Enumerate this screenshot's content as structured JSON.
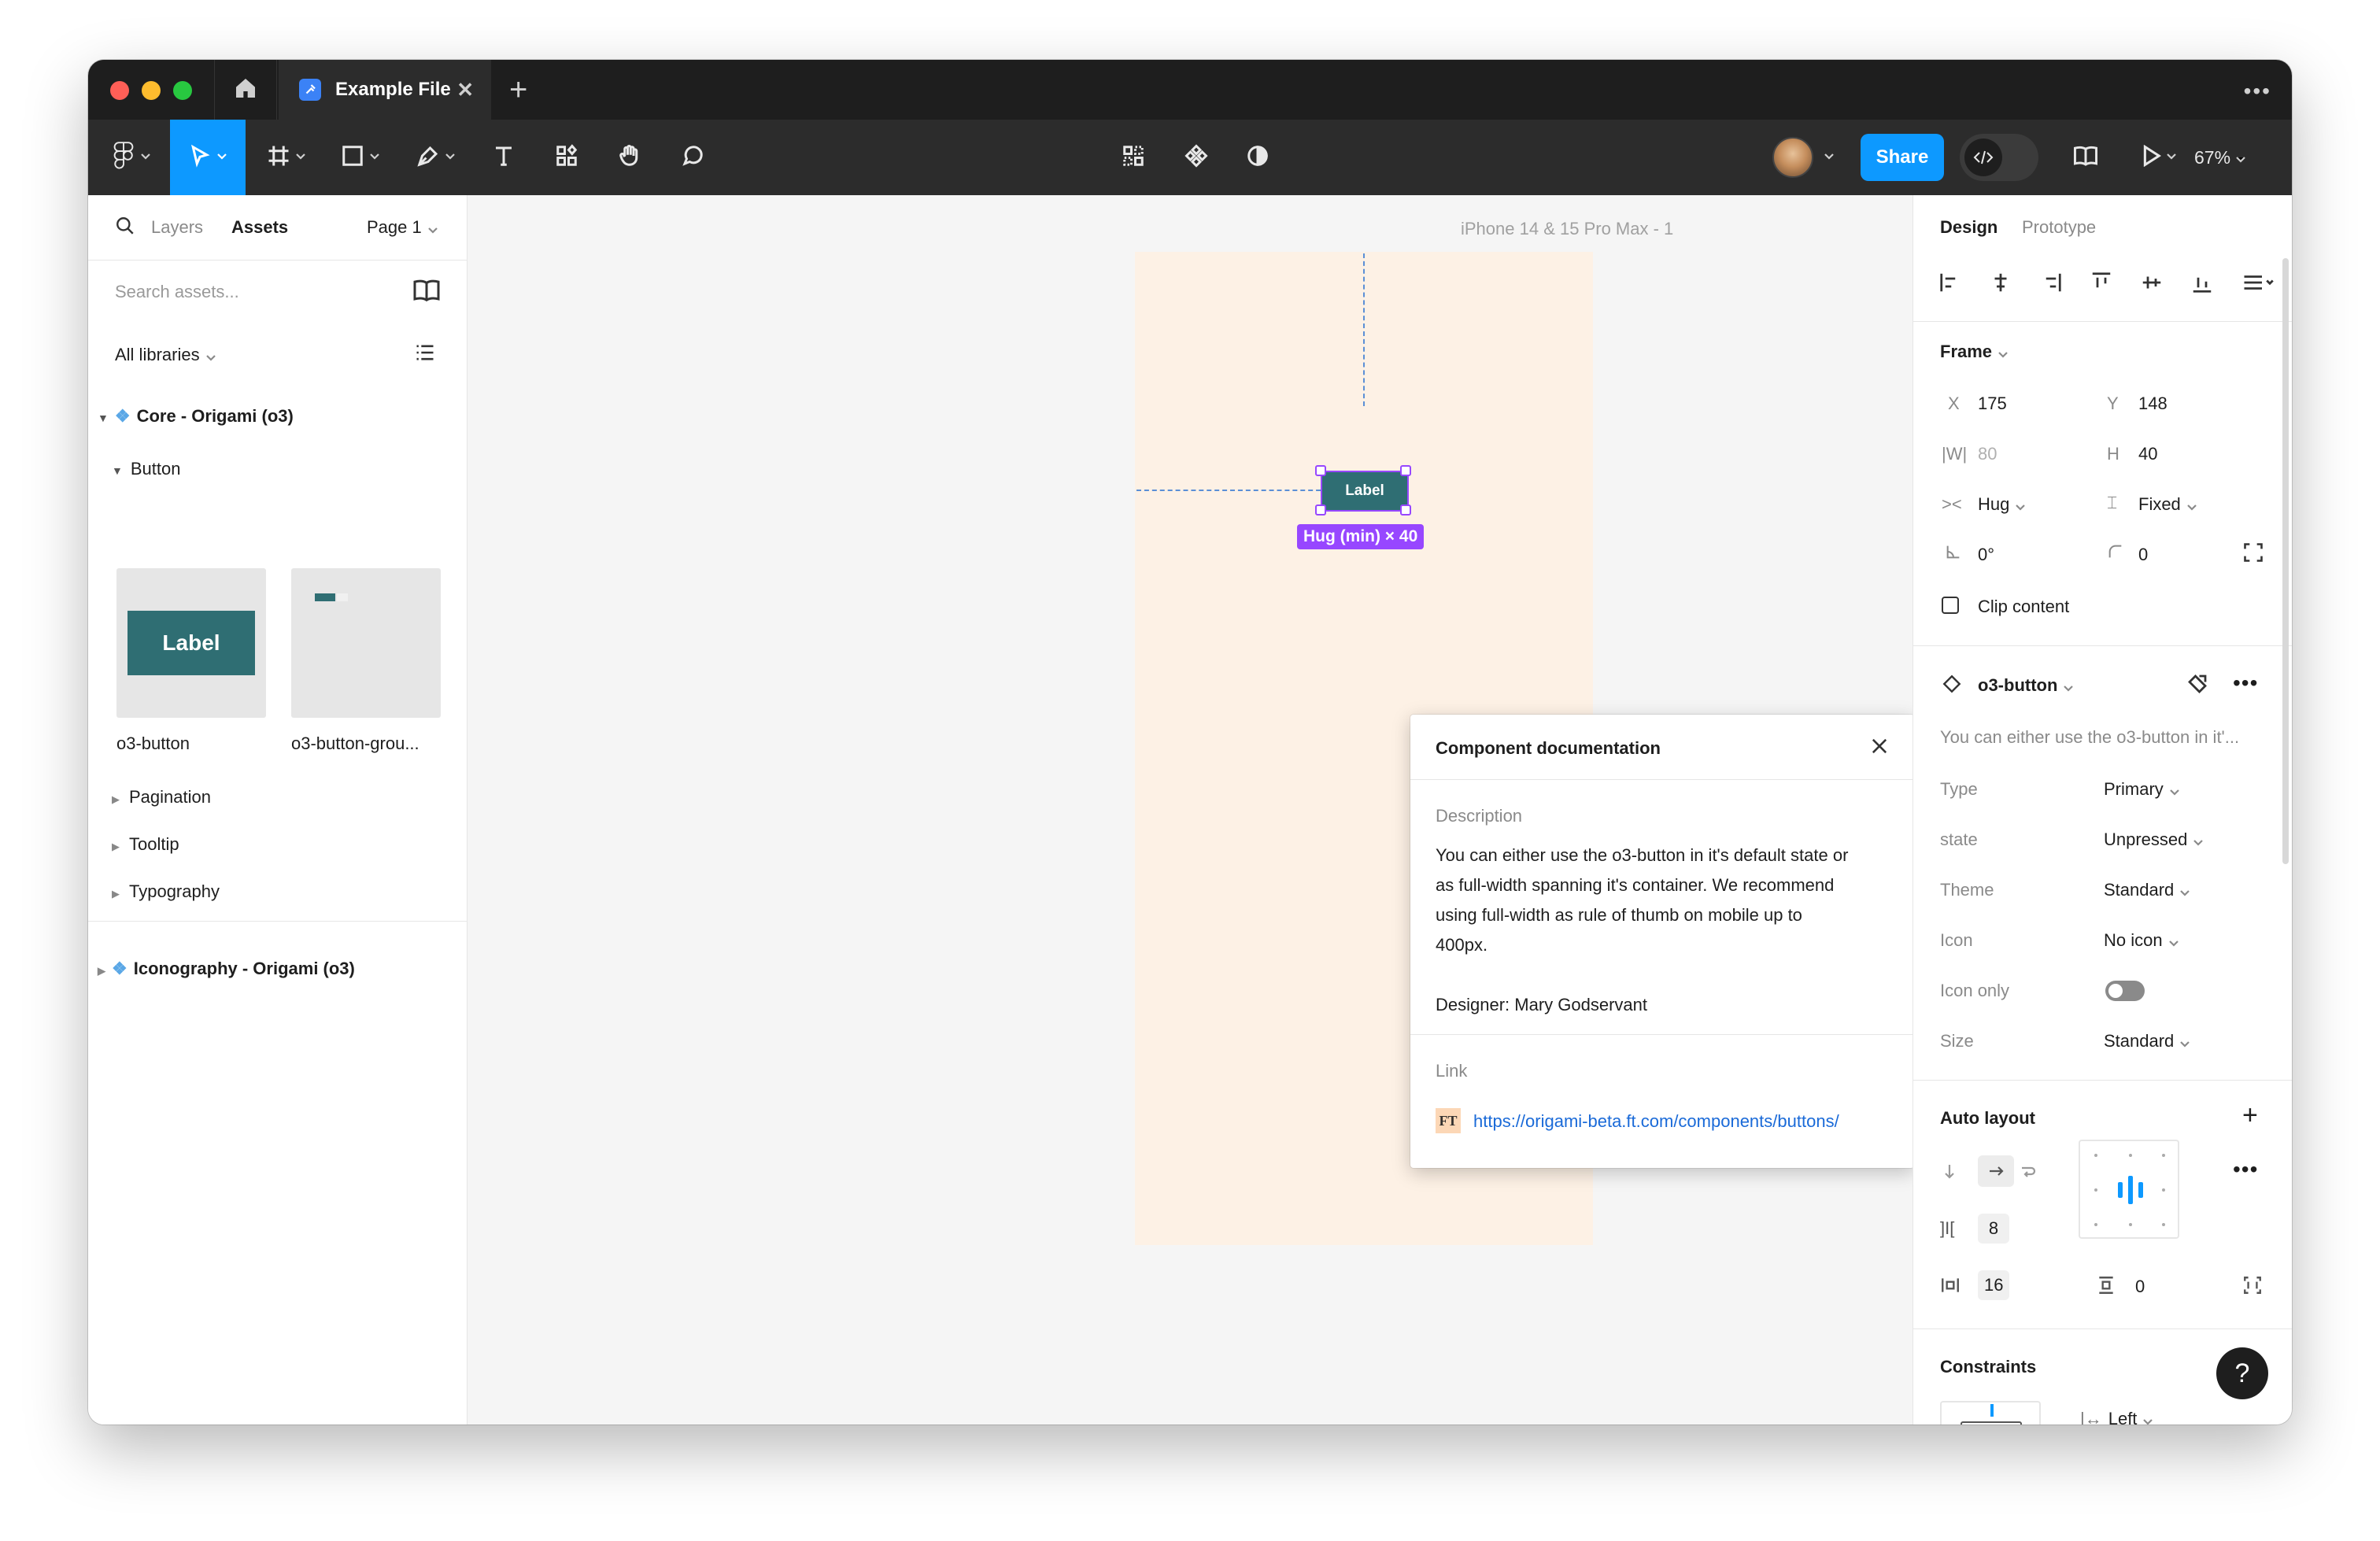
{
  "tabs": {
    "home_icon": "home-icon",
    "file_name": "Example File"
  },
  "toolbar": {
    "share_label": "Share",
    "zoom": "67%"
  },
  "left_panel": {
    "tab_layers": "Layers",
    "tab_assets": "Assets",
    "page": "Page 1",
    "search_placeholder": "Search assets...",
    "libraries": "All libraries",
    "library1": "Core - Origami (o3)",
    "group_button": "Button",
    "thumb1_label": "Label",
    "asset1": "o3-button",
    "asset2": "o3-button-grou...",
    "group_pagination": "Pagination",
    "group_tooltip": "Tooltip",
    "group_typography": "Typography",
    "library2": "Iconography - Origami (o3)"
  },
  "canvas": {
    "frame_name": "iPhone 14 & 15 Pro Max - 1",
    "button_label": "Label",
    "size_badge": "Hug (min) × 40"
  },
  "popup": {
    "title": "Component documentation",
    "desc_heading": "Description",
    "desc_line1": "You can either use the o3-button in it's default state or",
    "desc_line2": "as full-width spanning it's container. We recommend",
    "desc_line3": "using full-width as rule of thumb on mobile up to",
    "desc_line4": "400px.",
    "designer": "Designer: Mary Godservant",
    "link_heading": "Link",
    "link_badge": "FT",
    "link_url": "https://origami-beta.ft.com/components/buttons/"
  },
  "right_panel": {
    "tab_design": "Design",
    "tab_prototype": "Prototype",
    "frame_section": "Frame",
    "x_label": "X",
    "x_value": "175",
    "y_label": "Y",
    "y_value": "148",
    "w_label": "|W|",
    "w_value": "80",
    "h_label": "H",
    "h_value": "40",
    "w_sizing": "Hug",
    "h_sizing": "Fixed",
    "rotation": "0°",
    "radius": "0",
    "clip_content": "Clip content",
    "component_name": "o3-button",
    "component_desc": "You can either use the o3-button in it'...",
    "props": [
      {
        "label": "Type",
        "value": "Primary"
      },
      {
        "label": "state",
        "value": "Unpressed"
      },
      {
        "label": "Theme",
        "value": "Standard"
      },
      {
        "label": "Icon",
        "value": "No icon"
      },
      {
        "label": "Icon only",
        "value": ""
      },
      {
        "label": "Size",
        "value": "Standard"
      }
    ],
    "auto_layout": "Auto layout",
    "gap": "8",
    "padding_h": "16",
    "padding_v": "0",
    "constraints": "Constraints",
    "constraint_h": "Left",
    "help": "?"
  },
  "colors": {
    "accent": "#0d99ff",
    "selection": "#9747ff",
    "button": "#2f6e73",
    "frame_bg": "#fdf1e5"
  }
}
